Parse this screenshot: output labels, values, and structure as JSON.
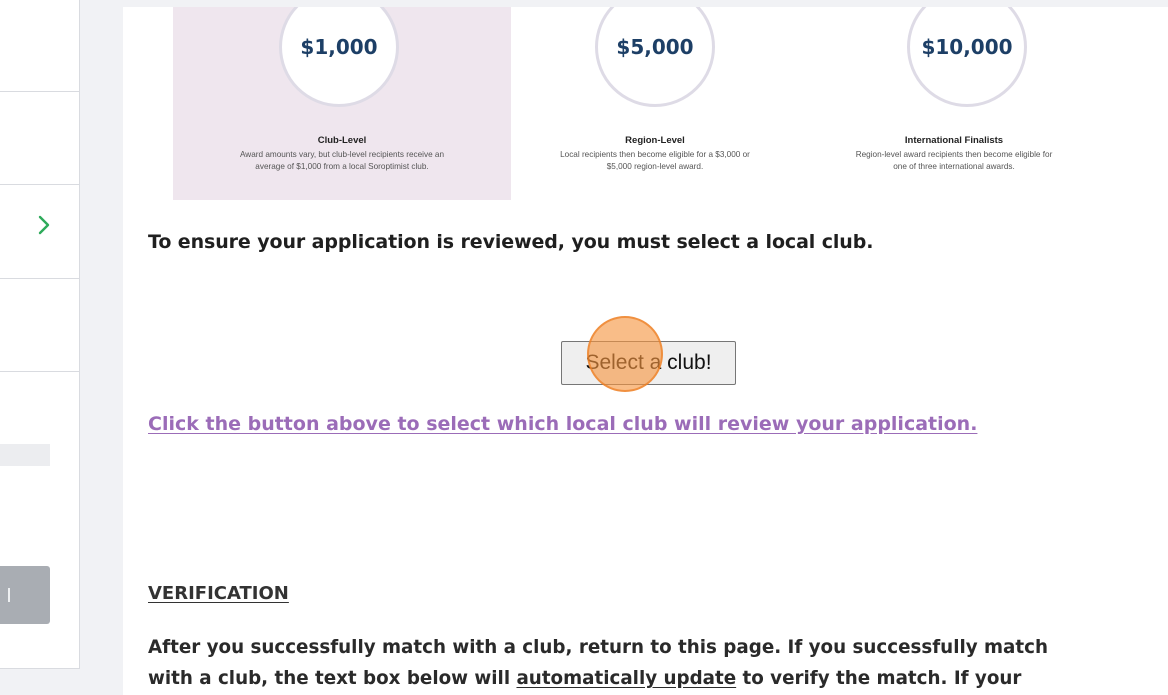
{
  "awards": [
    {
      "amount": "$1,000",
      "title": "Club-Level",
      "desc1": "Award amounts vary, but club-level recipients receive an",
      "desc2": "average of $1,000 from a local Soroptimist club."
    },
    {
      "amount": "$5,000",
      "title": "Region-Level",
      "desc1": "Local recipients then become eligible for a $3,000 or",
      "desc2": "$5,000 region-level award."
    },
    {
      "amount": "$10,000",
      "title": "International Finalists",
      "desc1": "Region-level award recipients then become eligible for",
      "desc2": "one of three international awards."
    }
  ],
  "instruction": "To ensure your application is reviewed, you must select a local club.",
  "select_button": "Select a club!",
  "review_link": "Click the button above to select which local club will review your application.",
  "verification": {
    "heading": "VERIFICATION",
    "line1": "After you successfully match with a club, return to this page. If you successfully match",
    "line2_pre": "with a club, the text box below will ",
    "line2_link": "automatically update",
    "line2_post": " to verify the match. If your"
  },
  "colors": {
    "accent_link": "#9b6cb8",
    "amount_text": "#1d3f66",
    "highlight_card": "#efe6ee",
    "chevron": "#2eaa5a",
    "click_marker": "#f6953f"
  },
  "icons": {
    "sidebar_chevron": "chevron-right-icon"
  }
}
